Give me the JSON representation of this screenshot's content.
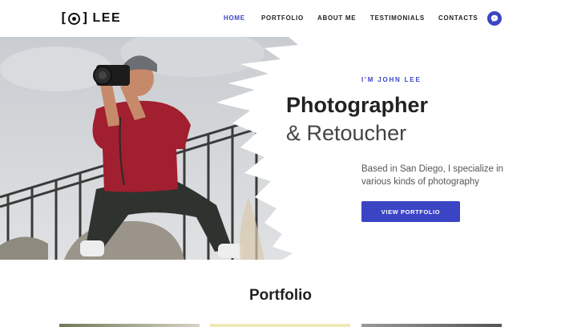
{
  "header": {
    "logo_text": "LEE",
    "nav": [
      {
        "label": "HOME",
        "active": true
      },
      {
        "label": "PORTFOLIO",
        "active": false
      },
      {
        "label": "ABOUT ME",
        "active": false
      },
      {
        "label": "TESTIMONIALS",
        "active": false
      },
      {
        "label": "CONTACTS",
        "active": false
      }
    ],
    "chat_icon": "messenger-icon"
  },
  "hero": {
    "eyebrow": "I'M JOHN LEE",
    "title": "Photographer",
    "subtitle": "& Retoucher",
    "description": "Based in San Diego, I specialize in various kinds of photography",
    "cta_label": "VIEW PORTFOLIO",
    "photo_icon": "photographer-photo"
  },
  "portfolio": {
    "title": "Portfolio"
  },
  "colors": {
    "accent": "#3b45c4",
    "text": "#222222"
  }
}
